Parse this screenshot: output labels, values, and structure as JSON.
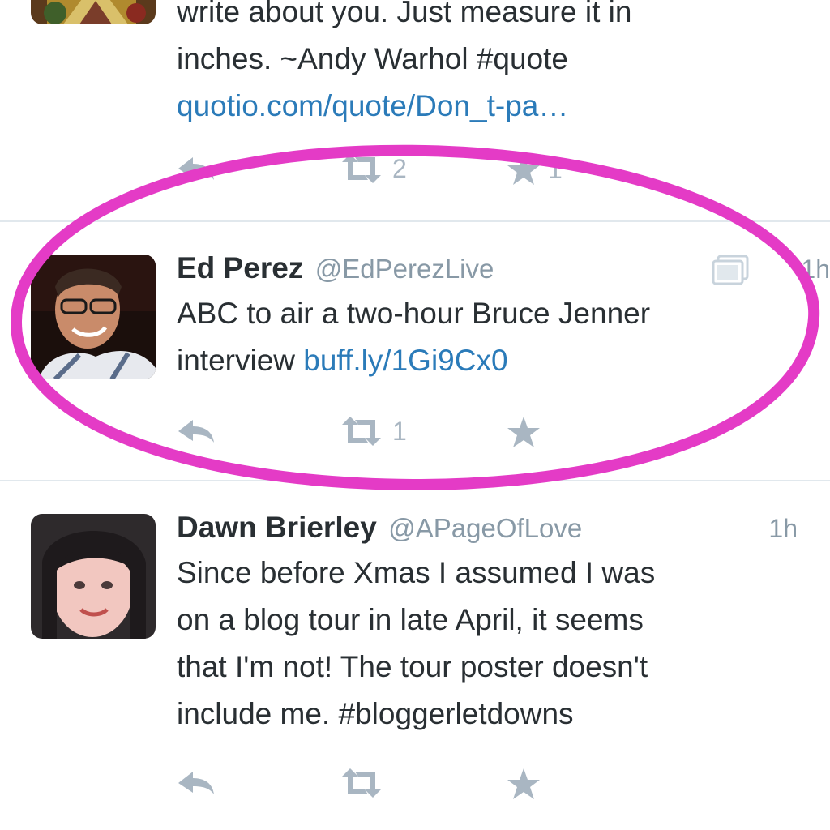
{
  "colors": {
    "text": "#292f33",
    "meta": "#8899a6",
    "link": "#2b7bb9",
    "action": "#a9b6c2",
    "divider": "#e1e8ed",
    "highlight": "#e43bc6"
  },
  "tweets": [
    {
      "line1": "write about you. Just measure it in",
      "line2": "inches. ~Andy Warhol #quote",
      "link": "quotio.com/quote/Don_t-pa…",
      "actions": {
        "retweet_count": "2",
        "favorite_count": "1"
      }
    },
    {
      "name": "Ed Perez",
      "handle": "@EdPerezLive",
      "time": "1h",
      "text_line1": "ABC to air a two-hour Bruce Jenner",
      "text_line2": "interview",
      "link": "buff.ly/1Gi9Cx0",
      "actions": {
        "retweet_count": "1"
      },
      "icons": [
        "photo-stack-icon"
      ]
    },
    {
      "name": "Dawn Brierley",
      "handle": "@APageOfLove",
      "time": "1h",
      "lines": [
        "Since before Xmas I assumed I was",
        "on a blog tour in late April, it seems",
        "that I'm not! The tour poster doesn't",
        "include me. #bloggerletdowns"
      ]
    }
  ]
}
